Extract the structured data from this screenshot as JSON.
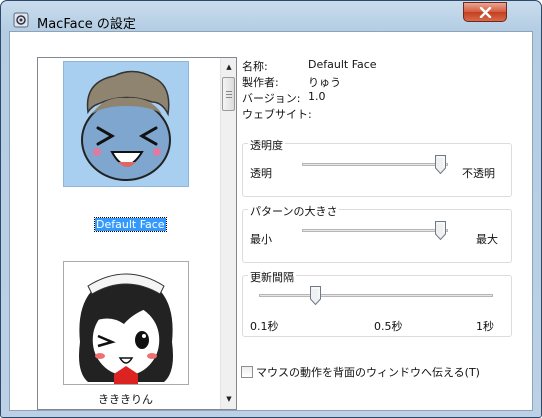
{
  "window": {
    "title": "MacFace の設定"
  },
  "faces": [
    {
      "label": "Default Face",
      "selected": true
    },
    {
      "label": "きききりん",
      "selected": false
    }
  ],
  "info": {
    "name_label": "名称:",
    "name_value": "Default Face",
    "author_label": "製作者:",
    "author_value": "りゅう",
    "version_label": "バージョン:",
    "version_value": "1.0",
    "website_label": "ウェブサイト:",
    "website_value": ""
  },
  "transparency": {
    "title": "透明度",
    "min_label": "透明",
    "max_label": "不透明",
    "value": 0.95
  },
  "pattern_size": {
    "title": "パターンの大きさ",
    "min_label": "最小",
    "max_label": "最大",
    "value": 0.95
  },
  "update_interval": {
    "title": "更新間隔",
    "label_min": "0.1秒",
    "label_mid": "0.5秒",
    "label_max": "1秒",
    "value": 0.24
  },
  "checkbox": {
    "label": "マウスの動作を背面のウィンドウへ伝える(T)",
    "checked": false
  },
  "icons": {
    "app": "gear-icon",
    "close": "close-icon",
    "scroll_up": "arrow-up-icon",
    "scroll_down": "arrow-down-icon"
  },
  "colors": {
    "selection": "#3399ff",
    "face_bg": "#a9cff0",
    "close_button": "#c33f1f"
  }
}
